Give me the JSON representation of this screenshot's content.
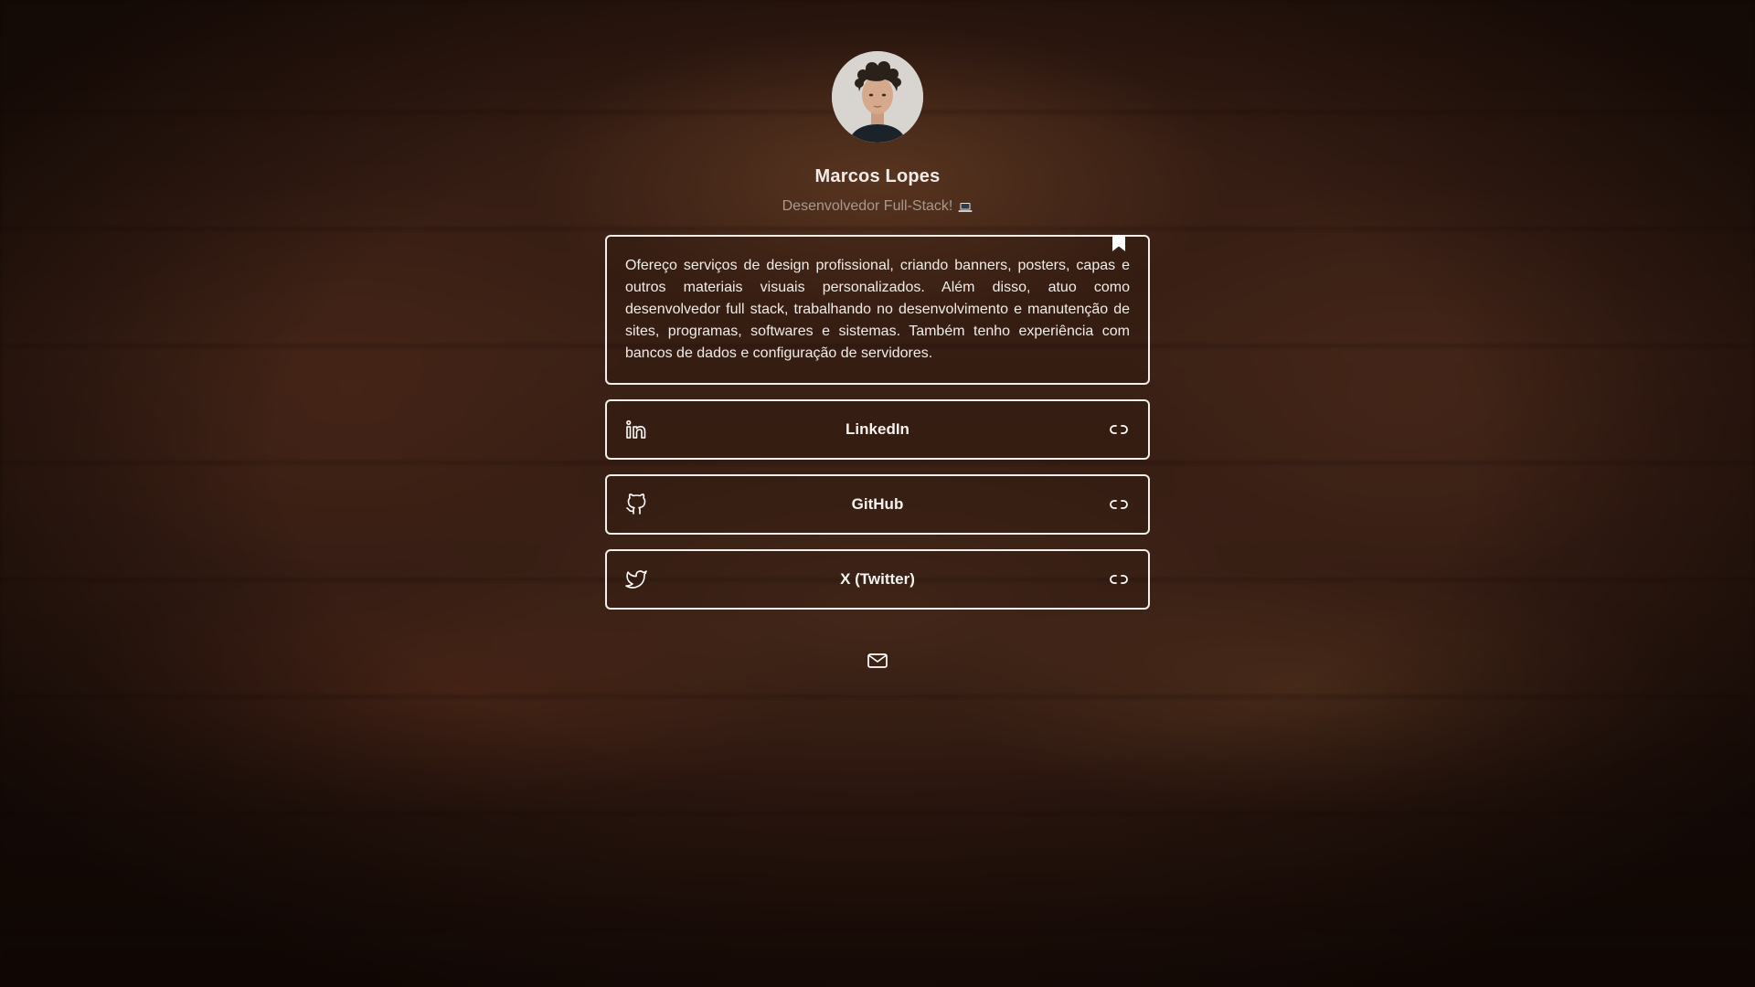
{
  "profile": {
    "name": "Marcos Lopes",
    "subtitle": "Desenvolvedor Full-Stack!",
    "avatar_icon": "person-avatar"
  },
  "bio": {
    "text": "Ofereço serviços de design profissional, criando banners, posters, capas e outros materiais visuais personalizados. Além disso, atuo como desenvolvedor full stack, trabalhando no desenvolvimento e manutenção de sites, programas, softwares e sistemas. Também tenho experiência com bancos de dados e configuração de servidores.",
    "icon": "bookmark-icon"
  },
  "links": [
    {
      "label": "LinkedIn",
      "icon": "linkedin-icon",
      "action_icon": "link-icon"
    },
    {
      "label": "GitHub",
      "icon": "github-icon",
      "action_icon": "link-icon"
    },
    {
      "label": "X (Twitter)",
      "icon": "twitter-icon",
      "action_icon": "link-icon"
    }
  ],
  "contact": {
    "icon": "mail-icon"
  },
  "colors": {
    "border": "#f2efec",
    "text": "#f1ece8",
    "subtitle": "#a8998f",
    "background": "#3a2015"
  }
}
